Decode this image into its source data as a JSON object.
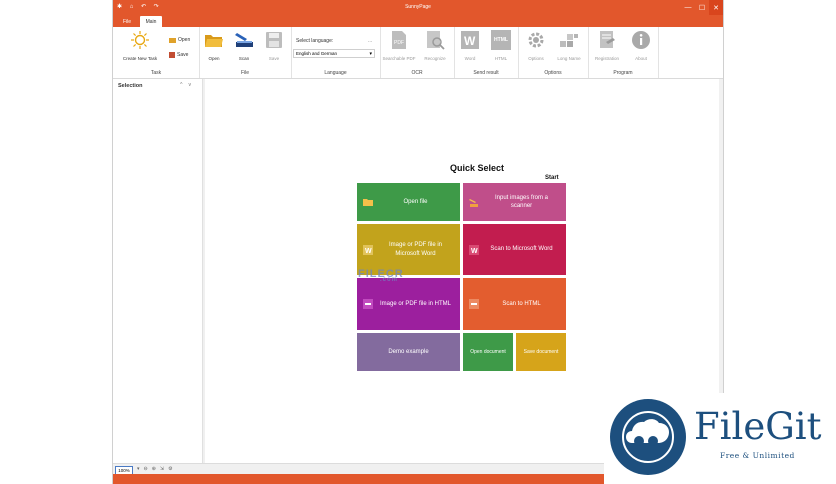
{
  "app": {
    "title": "SunnyPage"
  },
  "quick_access": "✱ ⌂ ↶ ↷",
  "window_controls": {
    "minimize": "—",
    "maximize": "☐",
    "close": "✕"
  },
  "tabs": [
    {
      "label": "File"
    },
    {
      "label": "Main"
    }
  ],
  "ribbon": {
    "task": {
      "group_label": "Task",
      "create_new_task": "Create New Task",
      "open": "Open",
      "save": "Save"
    },
    "file": {
      "group_label": "File",
      "open": "Open",
      "scan": "Scan",
      "save": "Save"
    },
    "language": {
      "group_label": "Language",
      "select_label": "Select language:",
      "selected_value": "English and German",
      "more": "..."
    },
    "ocr": {
      "group_label": "OCR",
      "searchable_pdf": "Searchable PDF",
      "recognize": "Recognize"
    },
    "send_result": {
      "group_label": "Send result",
      "word": "Word",
      "html": "HTML",
      "html_icon_text": "HTML"
    },
    "options": {
      "group_label": "Options",
      "options": "Options",
      "long_name": "Long Name"
    },
    "program": {
      "group_label": "Program",
      "registration": "Registration",
      "about": "About"
    }
  },
  "sidebar": {
    "title": "Selection",
    "collapse": "^",
    "expand": "v"
  },
  "quick_select": {
    "title": "Quick Select",
    "start_label": "Start",
    "tiles": [
      {
        "label": "Open file",
        "color": "#3e9a48"
      },
      {
        "label": "Input images from a scanner",
        "color": "#c04e8a"
      },
      {
        "label": "Image or PDF file in Microsoft Word",
        "color": "#c2a31c"
      },
      {
        "label": "Scan to Microsoft Word",
        "color": "#c21d4f"
      },
      {
        "label": "Image or PDF file in HTML",
        "color": "#9c1f9e"
      },
      {
        "label": "Scan to HTML",
        "color": "#e35d2f"
      },
      {
        "label": "Demo example",
        "color": "#836b9e"
      },
      {
        "label": "Open document",
        "color": "#3e9a48"
      },
      {
        "label": "Save document",
        "color": "#d6a41a"
      }
    ]
  },
  "watermark": {
    "text": "FILECR",
    "sub": ".com"
  },
  "status": {
    "zoom": "100%"
  },
  "brand": {
    "name": "FileGit",
    "tagline": "Free & Unlimited",
    "color": "#1d4f7e"
  },
  "accent": "#e2572c"
}
